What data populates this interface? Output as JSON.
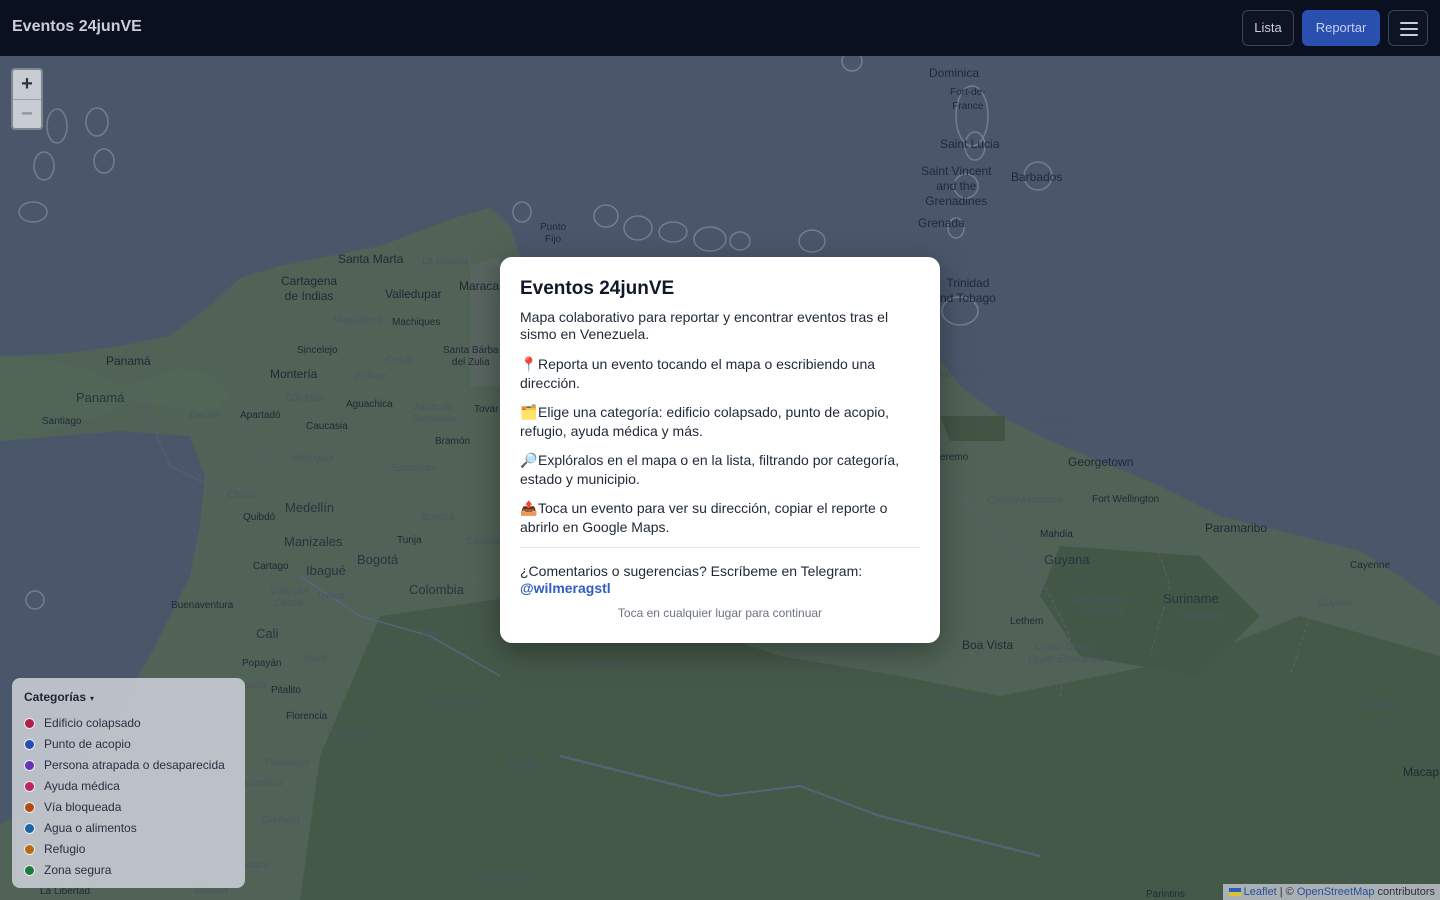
{
  "app": {
    "title": "Eventos 24junVE"
  },
  "header": {
    "list_label": "Lista",
    "report_label": "Reportar",
    "menu_icon": "hamburger-menu-icon"
  },
  "map": {
    "zoom_in_label": "+",
    "zoom_out_label": "−",
    "places": [
      {
        "key": "dominica",
        "label": "Dominica"
      },
      {
        "key": "fort_de_france",
        "label": "Fort-de-\nFrance"
      },
      {
        "key": "saint_lucia",
        "label": "Saint Lucia"
      },
      {
        "key": "saint_vincent",
        "label": "Saint Vincent\nand the\nGrenadines"
      },
      {
        "key": "barbados",
        "label": "Barbados"
      },
      {
        "key": "grenada",
        "label": "Grenada"
      },
      {
        "key": "trinidad",
        "label": "Trinidad\nnd Tobago"
      },
      {
        "key": "punto_fijo",
        "label": "Punto\nFijo"
      },
      {
        "key": "santa_marta",
        "label": "Santa Marta"
      },
      {
        "key": "la_guajira",
        "label": "La Guajira"
      },
      {
        "key": "maraca",
        "label": "Maraca"
      },
      {
        "key": "cartagena",
        "label": "Cartagena\nde Indias"
      },
      {
        "key": "valledupar",
        "label": "Valledupar"
      },
      {
        "key": "magdalena",
        "label": "Magdalena"
      },
      {
        "key": "machiques",
        "label": "Machiques"
      },
      {
        "key": "santa_barbara",
        "label": "Santa Bárba\ndel Zulia"
      },
      {
        "key": "sincelejo",
        "label": "Sincelejo"
      },
      {
        "key": "cesar",
        "label": "Cesar"
      },
      {
        "key": "panama_city",
        "label": "Panamá"
      },
      {
        "key": "panama",
        "label": "Panamá"
      },
      {
        "key": "monteria",
        "label": "Montería"
      },
      {
        "key": "bolivar",
        "label": "Bolívar"
      },
      {
        "key": "cordoba",
        "label": "Córdoba"
      },
      {
        "key": "aguachica",
        "label": "Aguachica"
      },
      {
        "key": "norte_santander",
        "label": "Norte de\nSantander"
      },
      {
        "key": "tovar",
        "label": "Tovar"
      },
      {
        "key": "santiago",
        "label": "Santiago"
      },
      {
        "key": "darien",
        "label": "Darién"
      },
      {
        "key": "apartado",
        "label": "Apartadó"
      },
      {
        "key": "caucasia",
        "label": "Caucasia"
      },
      {
        "key": "bramon",
        "label": "Bramón"
      },
      {
        "key": "antioquia",
        "label": "Antioquia"
      },
      {
        "key": "santander",
        "label": "Santander"
      },
      {
        "key": "choco",
        "label": "Chocó"
      },
      {
        "key": "quibdo",
        "label": "Quibdó"
      },
      {
        "key": "medellin",
        "label": "Medellín"
      },
      {
        "key": "boyaca",
        "label": "Boyacá"
      },
      {
        "key": "tunja",
        "label": "Tunja"
      },
      {
        "key": "casanare",
        "label": "Casanare"
      },
      {
        "key": "manizales",
        "label": "Manizales"
      },
      {
        "key": "bogota",
        "label": "Bogotá"
      },
      {
        "key": "cartago",
        "label": "Cartago"
      },
      {
        "key": "ibague",
        "label": "Ibagué"
      },
      {
        "key": "colombia",
        "label": "Colombia"
      },
      {
        "key": "buenaventura",
        "label": "Buenaventura"
      },
      {
        "key": "valle_cauca",
        "label": "Valle del\nCauca"
      },
      {
        "key": "tolima",
        "label": "Tolima"
      },
      {
        "key": "cali",
        "label": "Cali"
      },
      {
        "key": "meta",
        "label": "Meta"
      },
      {
        "key": "popayan",
        "label": "Popayán"
      },
      {
        "key": "huila",
        "label": "Huila"
      },
      {
        "key": "cauca",
        "label": "auca"
      },
      {
        "key": "pitalito",
        "label": "Pitalito"
      },
      {
        "key": "guaviare",
        "label": "Guaviare"
      },
      {
        "key": "guainia",
        "label": "Guainía"
      },
      {
        "key": "florencia",
        "label": "Florencia"
      },
      {
        "key": "caqueta",
        "label": "Caquetá"
      },
      {
        "key": "putumayo",
        "label": "Putumayo"
      },
      {
        "key": "vaupes",
        "label": "Vaupés"
      },
      {
        "key": "cumbios",
        "label": "cumbíos"
      },
      {
        "key": "orellana",
        "label": "Orellana"
      },
      {
        "key": "pastaza",
        "label": "staza"
      },
      {
        "key": "amazonas",
        "label": "Amazonas"
      },
      {
        "key": "la_libertad",
        "label": "La Libertad"
      },
      {
        "key": "morona",
        "label": "Morona"
      },
      {
        "key": "delta_amacuro",
        "label": "ta Amacuro"
      },
      {
        "key": "barima_waini",
        "label": "Barima-\nWaini"
      },
      {
        "key": "georgetown",
        "label": "Georgetown"
      },
      {
        "key": "uyeremo",
        "label": "eremo"
      },
      {
        "key": "cuyuni",
        "label": "Cuyuni-Mazaruni"
      },
      {
        "key": "fort_wellington",
        "label": "Fort Wellington"
      },
      {
        "key": "paramaribo",
        "label": "Paramaribo"
      },
      {
        "key": "mahdia",
        "label": "Mahdia"
      },
      {
        "key": "guyana",
        "label": "Guyana"
      },
      {
        "key": "cayenne",
        "label": "Cayenne"
      },
      {
        "key": "east_berbice",
        "label": "East Berbice-\nCorentyne"
      },
      {
        "key": "suriname",
        "label": "Suriname"
      },
      {
        "key": "sipaliwini",
        "label": "Sipaliwini"
      },
      {
        "key": "guyane",
        "label": "Guyane"
      },
      {
        "key": "lethem",
        "label": "Lethem"
      },
      {
        "key": "boa_vista",
        "label": "Boa Vista"
      },
      {
        "key": "upper_takutu",
        "label": "Upper Takutu-\nUpper Essequibo"
      },
      {
        "key": "roraima",
        "label": "Roraima"
      },
      {
        "key": "amapa",
        "label": "Amapá"
      },
      {
        "key": "macapa",
        "label": "Macap"
      },
      {
        "key": "parintins",
        "label": "Parintins"
      }
    ],
    "attribution": {
      "leaflet": "Leaflet",
      "separator": " | © ",
      "osm": "OpenStreetMap",
      "suffix": " contributors"
    }
  },
  "legend": {
    "title": "Categorías",
    "caret": "▾",
    "items": [
      {
        "label": "Edificio colapsado",
        "color": "#b31f4a"
      },
      {
        "label": "Punto de acopio",
        "color": "#2a4bb5"
      },
      {
        "label": "Persona atrapada o desaparecida",
        "color": "#6b2fb8"
      },
      {
        "label": "Ayuda médica",
        "color": "#c0245e"
      },
      {
        "label": "Vía bloqueada",
        "color": "#b34a16"
      },
      {
        "label": "Agua o alimentos",
        "color": "#1f63a8"
      },
      {
        "label": "Refugio",
        "color": "#b76a12"
      },
      {
        "label": "Zona segura",
        "color": "#1c7a3a"
      }
    ]
  },
  "modal": {
    "title": "Eventos 24junVE",
    "intro": "Mapa colaborativo para reportar y encontrar eventos tras el sismo en Venezuela.",
    "steps": [
      {
        "icon": "📍",
        "icon_name": "pin-icon",
        "text": "Reporta un evento tocando el mapa o escribiendo una dirección."
      },
      {
        "icon": "🗂️",
        "icon_name": "folder-icon",
        "text": "Elige una categoría: edificio colapsado, punto de acopio, refugio, ayuda médica y más."
      },
      {
        "icon": "🔎",
        "icon_name": "magnifier-icon",
        "text": "Explóralos en el mapa o en la lista, filtrando por categoría, estado y municipio."
      },
      {
        "icon": "📤",
        "icon_name": "share-icon",
        "text": "Toca un evento para ver su dirección, copiar el reporte o abrirlo en Google Maps."
      }
    ],
    "feedback_text": "¿Comentarios o sugerencias? Escríbeme en Telegram:",
    "telegram_handle": "@wilmeragstl",
    "continue_hint": "Toca en cualquier lugar para continuar"
  }
}
